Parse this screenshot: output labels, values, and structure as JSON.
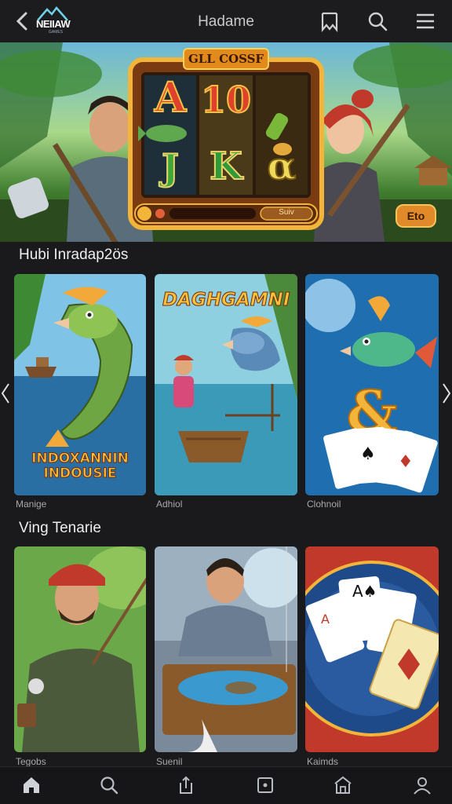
{
  "header": {
    "logo_text": "NEIIAW",
    "logo_sub": "GAMES",
    "title": "Hadame"
  },
  "hero": {
    "slot_banner": "GLL COSSF",
    "reels": [
      "A",
      "10",
      "J",
      "K",
      "α"
    ],
    "spin_label": "Suiv",
    "side_button": "Eto"
  },
  "sections": [
    {
      "title": "Hubi Inradap2ös",
      "cards": [
        {
          "art_text": "INDOXANNIN INDOUSIE",
          "caption": "Manige"
        },
        {
          "art_text": "DAGHGAMNI",
          "caption": "Adhiol"
        },
        {
          "art_text": "",
          "caption": "Clohnoil"
        }
      ]
    },
    {
      "title": "Ving Tenarie",
      "cards": [
        {
          "caption": "Tegobs"
        },
        {
          "caption": "Suenil"
        },
        {
          "caption": "Kaimds"
        }
      ]
    }
  ],
  "colors": {
    "background": "#1a1a1c",
    "accent_gold": "#f2b53a",
    "nav_bg": "#161618"
  },
  "nav": [
    "home-icon",
    "search-icon",
    "share-icon",
    "wallet-icon",
    "store-icon",
    "profile-icon"
  ]
}
